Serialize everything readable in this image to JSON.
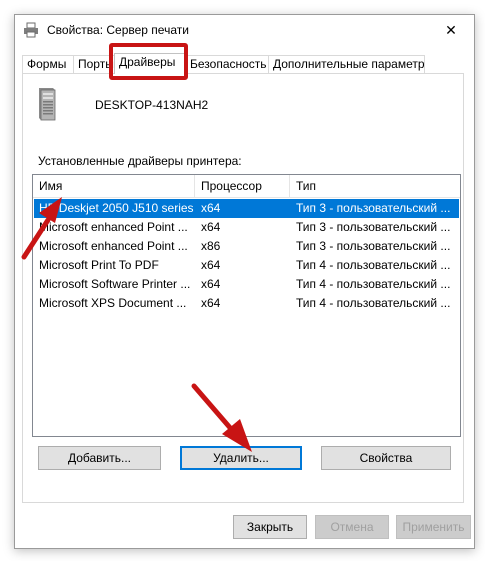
{
  "window": {
    "title": "Свойства: Сервер печати",
    "close_glyph": "✕"
  },
  "tabs": [
    {
      "label": "Формы"
    },
    {
      "label": "Порты"
    },
    {
      "label": "Драйверы"
    },
    {
      "label": "Безопасность"
    },
    {
      "label": "Дополнительные параметры"
    }
  ],
  "server": {
    "name": "DESKTOP-413NAH2",
    "icon": "server-tower-icon"
  },
  "drivers": {
    "caption": "Установленные драйверы принтера:",
    "columns": [
      "Имя",
      "Процессор",
      "Тип"
    ],
    "rows": [
      {
        "name": "HP Deskjet 2050 J510 series",
        "cpu": "x64",
        "type": "Тип 3 - пользовательский ..."
      },
      {
        "name": "Microsoft enhanced Point ...",
        "cpu": "x64",
        "type": "Тип 3 - пользовательский ..."
      },
      {
        "name": "Microsoft enhanced Point ...",
        "cpu": "x86",
        "type": "Тип 3 - пользовательский ..."
      },
      {
        "name": "Microsoft Print To PDF",
        "cpu": "x64",
        "type": "Тип 4 - пользовательский ..."
      },
      {
        "name": "Microsoft Software Printer ...",
        "cpu": "x64",
        "type": "Тип 4 - пользовательский ..."
      },
      {
        "name": "Microsoft XPS Document ...",
        "cpu": "x64",
        "type": "Тип 4 - пользовательский ..."
      }
    ]
  },
  "actions": {
    "add": "Добавить...",
    "remove": "Удалить...",
    "properties": "Свойства"
  },
  "footer": {
    "close": "Закрыть",
    "cancel": "Отмена",
    "apply": "Применить"
  },
  "colors": {
    "selection": "#0078d7",
    "annotation": "#c81414"
  }
}
